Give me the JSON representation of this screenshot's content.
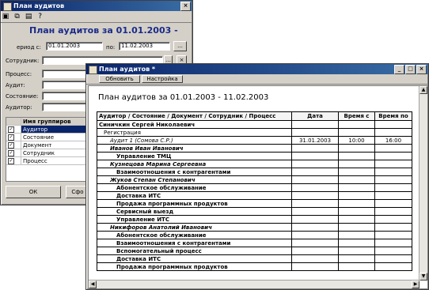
{
  "back_window": {
    "title": "План аудитов",
    "heading": "План аудитов за 01.01.2003 -",
    "period_label": "ериод с:",
    "date_from": "01.01.2003",
    "po_label": "по:",
    "date_to": "11.02.2003",
    "ellipsis": "...",
    "filters": [
      {
        "label": "Сотрудник:"
      },
      {
        "label": "Процесс:"
      },
      {
        "label": "Аудит:"
      },
      {
        "label": "Состояние:"
      },
      {
        "label": "Аудитор:"
      }
    ],
    "grid_header": "Имя группиров",
    "grid_rows": [
      {
        "checked": true,
        "name": "Аудитор"
      },
      {
        "checked": true,
        "name": "Состояние"
      },
      {
        "checked": true,
        "name": "Документ"
      },
      {
        "checked": true,
        "name": "Сотрудник"
      },
      {
        "checked": true,
        "name": "Процесс"
      }
    ],
    "ok_label": "ОК",
    "form_label": "Сфо"
  },
  "front_window": {
    "title": "План аудитов *",
    "toolbar": {
      "refresh": "Обновить",
      "settings": "Настройка"
    },
    "report_title": "План аудитов за 01.01.2003 - 11.02.2003",
    "columns": [
      "Аудитор / Состояние / Документ / Сотрудник / Процесс",
      "Дата",
      "Время с",
      "Время по"
    ],
    "rows": [
      {
        "level": 0,
        "text": "Синичкин Сергей Николаевич",
        "date": "",
        "from": "",
        "to": "",
        "bold": true
      },
      {
        "level": 1,
        "text": "Регистрация",
        "date": "",
        "from": "",
        "to": "",
        "bold": false
      },
      {
        "level": 2,
        "text": "Аудит 1 (Сомова С.Р.)",
        "date": "31.01.2003",
        "from": "10:00",
        "to": "16:00",
        "bold": false,
        "italic": true
      },
      {
        "level": 2,
        "text": "Иванов Иван Иванович",
        "date": "",
        "from": "",
        "to": "",
        "bold": true,
        "italic": true
      },
      {
        "level": 3,
        "text": "Управление ТМЦ",
        "date": "",
        "from": "",
        "to": "",
        "bold": true
      },
      {
        "level": 2,
        "text": "Кузнецова Марина Сергеевна",
        "date": "",
        "from": "",
        "to": "",
        "bold": true,
        "italic": true
      },
      {
        "level": 3,
        "text": "Взаимоотношения с контрагентами",
        "date": "",
        "from": "",
        "to": "",
        "bold": true
      },
      {
        "level": 2,
        "text": "Жуков Степан Степанович",
        "date": "",
        "from": "",
        "to": "",
        "bold": true,
        "italic": true
      },
      {
        "level": 3,
        "text": "Абонентское обслуживание",
        "date": "",
        "from": "",
        "to": "",
        "bold": true
      },
      {
        "level": 3,
        "text": "Доставка ИТС",
        "date": "",
        "from": "",
        "to": "",
        "bold": true
      },
      {
        "level": 3,
        "text": "Продажа программных продуктов",
        "date": "",
        "from": "",
        "to": "",
        "bold": true
      },
      {
        "level": 3,
        "text": "Сервисный выезд",
        "date": "",
        "from": "",
        "to": "",
        "bold": true
      },
      {
        "level": 3,
        "text": "Управление ИТС",
        "date": "",
        "from": "",
        "to": "",
        "bold": true
      },
      {
        "level": 2,
        "text": "Никифоров Анатолий Иванович",
        "date": "",
        "from": "",
        "to": "",
        "bold": true,
        "italic": true
      },
      {
        "level": 3,
        "text": "Абонентское обслуживание",
        "date": "",
        "from": "",
        "to": "",
        "bold": true
      },
      {
        "level": 3,
        "text": "Взаимоотношения с контрагентами",
        "date": "",
        "from": "",
        "to": "",
        "bold": true
      },
      {
        "level": 3,
        "text": "Вспомогательный процесс",
        "date": "",
        "from": "",
        "to": "",
        "bold": true
      },
      {
        "level": 3,
        "text": "Доставка ИТС",
        "date": "",
        "from": "",
        "to": "",
        "bold": true
      },
      {
        "level": 3,
        "text": "Продажа программных продуктов",
        "date": "",
        "from": "",
        "to": "",
        "bold": true
      }
    ]
  },
  "colors": {
    "title_blue": "#0a246a",
    "heading_blue": "#1a2a8a",
    "face": "#d4d0c8"
  }
}
